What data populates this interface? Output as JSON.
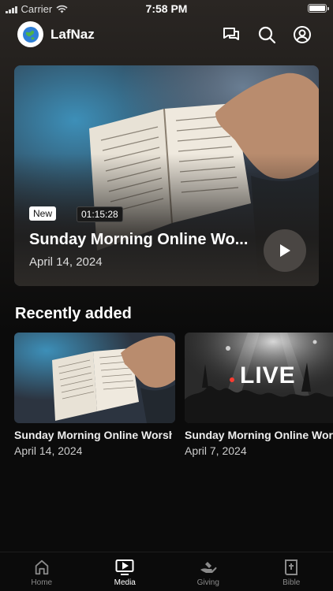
{
  "status_bar": {
    "carrier": "Carrier",
    "time": "7:58 PM"
  },
  "header": {
    "brand": "LafNaz",
    "icons": [
      "chat-icon",
      "search-icon",
      "profile-icon"
    ]
  },
  "hero": {
    "badge_new": "New",
    "duration": "01:15:28",
    "title": "Sunday Morning Online Wo...",
    "date": "April 14, 2024"
  },
  "recent": {
    "title": "Recently added",
    "items": [
      {
        "title": "Sunday Morning Online Worship",
        "date": "April 14, 2024"
      },
      {
        "title": "Sunday Morning Online Worship",
        "date": "April 7, 2024",
        "overlay": "LIVE"
      }
    ]
  },
  "tabs": [
    {
      "label": "Home",
      "icon": "home-icon"
    },
    {
      "label": "Media",
      "icon": "media-icon"
    },
    {
      "label": "Giving",
      "icon": "giving-icon"
    },
    {
      "label": "Bible",
      "icon": "bible-icon"
    }
  ],
  "colors": {
    "background": "#0b0b0b",
    "active_tab": "#ffffff",
    "inactive_tab": "#8a8a8a"
  }
}
